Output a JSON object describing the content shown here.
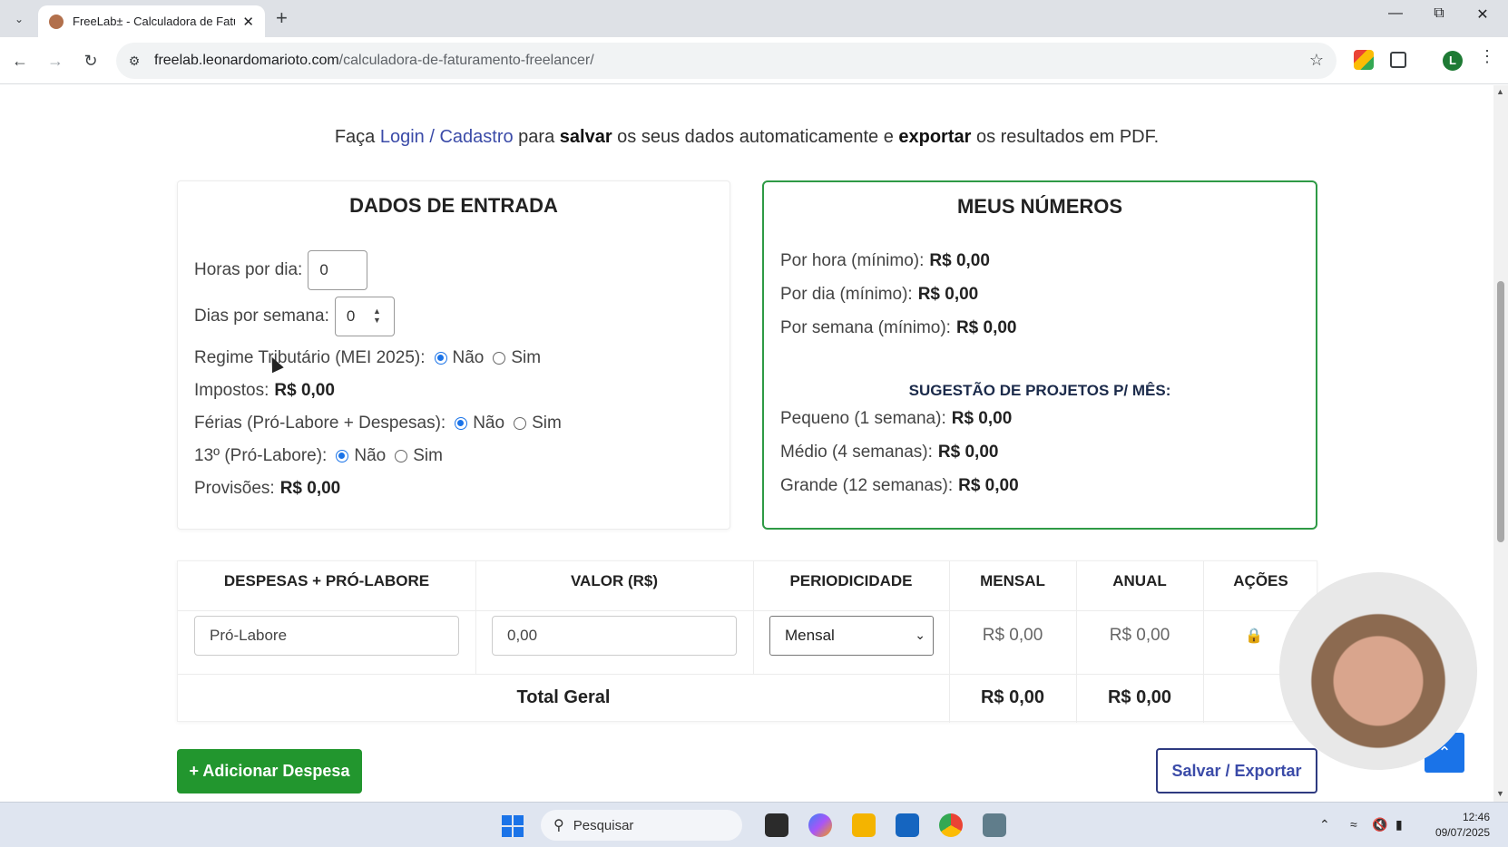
{
  "browser": {
    "tab_title": "FreeLab± - Calculadora de Fatu",
    "url_host": "freelab.leonardomarioto.com",
    "url_path": "/calculadora-de-faturamento-freelancer/",
    "profile_initial": "L"
  },
  "page": {
    "notice": {
      "prefix": "Faça ",
      "link": "Login / Cadastro",
      "mid1": " para ",
      "b1": "salvar",
      "mid2": " os seus dados automaticamente e ",
      "b2": "exportar",
      "suffix": " os resultados em PDF."
    },
    "entrada": {
      "title": "DADOS DE ENTRADA",
      "horas_label": "Horas por dia:",
      "horas_value": "0",
      "dias_label": "Dias por semana:",
      "dias_value": "0",
      "regime_label": "Regime Tributário (MEI 2025):",
      "impostos_label": "Impostos:",
      "impostos_value": "R$ 0,00",
      "ferias_label": "Férias (Pró-Labore + Despesas):",
      "decimo_label": "13º (Pró-Labore):",
      "provisoes_label": "Provisões:",
      "provisoes_value": "R$ 0,00",
      "nao": "Não",
      "sim": "Sim"
    },
    "numeros": {
      "title": "MEUS NÚMEROS",
      "hora_label": "Por hora (mínimo):",
      "hora_value": "R$ 0,00",
      "dia_label": "Por dia (mínimo):",
      "dia_value": "R$ 0,00",
      "semana_label": "Por semana (mínimo):",
      "semana_value": "R$ 0,00",
      "sugestao_title": "SUGESTÃO DE PROJETOS P/ MÊS:",
      "pequeno_label": "Pequeno (1 semana):",
      "pequeno_value": "R$ 0,00",
      "medio_label": "Médio (4 semanas):",
      "medio_value": "R$ 0,00",
      "grande_label": "Grande (12 semanas):",
      "grande_value": "R$ 0,00"
    },
    "table": {
      "headers": [
        "DESPESAS + PRÓ-LABORE",
        "VALOR (R$)",
        "PERIODICIDADE",
        "MENSAL",
        "ANUAL",
        "AÇÕES"
      ],
      "row": {
        "name": "Pró-Labore",
        "value": "0,00",
        "period": "Mensal",
        "mensal": "R$ 0,00",
        "anual": "R$ 0,00"
      },
      "total_label": "Total Geral",
      "total_mensal": "R$ 0,00",
      "total_anual": "R$ 0,00"
    },
    "buttons": {
      "add": "+ Adicionar Despesa",
      "save": "Salvar / Exportar"
    }
  },
  "taskbar": {
    "search_placeholder": "Pesquisar",
    "time": "12:46",
    "date": "09/07/2025"
  }
}
